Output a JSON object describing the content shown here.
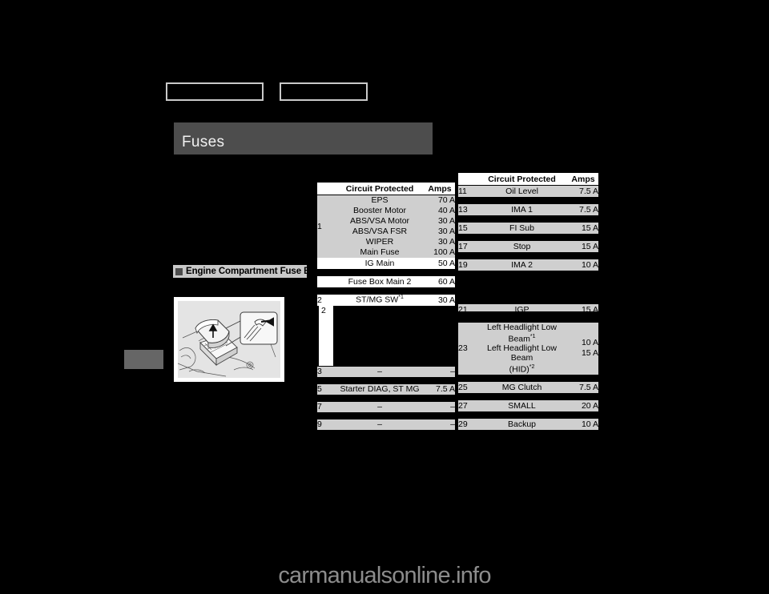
{
  "page": {
    "section_title": "Fuses",
    "subsection_title": "Engine Compartment Fuse Box",
    "watermark": "carmanualsonline.info",
    "colors": {
      "page_background": "#000000",
      "title_bar": "#4d4d4d",
      "subhead_bar": "#c9c9c9",
      "row_shade": "#cfcfcf",
      "row_plain": "#ffffff",
      "edge_tab": "#666666",
      "watermark_text": "#8c8c8c"
    },
    "top_boxes": [
      {
        "name": "redacted-box-left",
        "label": ""
      },
      {
        "name": "redacted-box-right",
        "label": ""
      }
    ],
    "illustration": {
      "name": "engine-compartment-fuse-box-illustration",
      "caption": ""
    }
  },
  "tables": {
    "left": {
      "headers": [
        "",
        "Circuit Protected",
        "Amps"
      ],
      "rows": [
        {
          "num": "1",
          "num_rowspan": 6,
          "desc": "EPS",
          "amps": "70 A",
          "style": "shade"
        },
        {
          "num": "",
          "desc": "Booster Motor",
          "amps": "40 A",
          "style": "shade"
        },
        {
          "num": "",
          "desc": "ABS/VSA Motor",
          "amps": "30 A",
          "style": "shade"
        },
        {
          "num": "",
          "desc": "ABS/VSA FSR",
          "amps": "30 A",
          "style": "shade"
        },
        {
          "num": "",
          "desc": "WIPER",
          "amps": "30 A",
          "style": "shade"
        },
        {
          "num": "",
          "desc": "Main Fuse",
          "amps": "100 A",
          "style": "shade"
        },
        {
          "num": "",
          "desc": "IG Main",
          "amps": "50 A",
          "style": "plain"
        },
        {
          "num": "",
          "desc": "Fuse Box Main 2",
          "amps": "60 A",
          "style": "plain"
        },
        {
          "num": "2",
          "desc": "ST/MG SW",
          "desc_sup": "*1",
          "amps": "30 A",
          "style": "plain"
        },
        {
          "num": "3",
          "desc": "–",
          "amps": "–",
          "style": "shade"
        },
        {
          "num": "5",
          "desc": "Starter DIAG, ST MG",
          "amps": "7.5 A",
          "style": "shade"
        },
        {
          "num": "7",
          "desc": "–",
          "amps": "–",
          "style": "shade"
        },
        {
          "num": "9",
          "desc": "–",
          "amps": "–",
          "style": "shade"
        }
      ]
    },
    "right": {
      "headers": [
        "",
        "Circuit Protected",
        "Amps"
      ],
      "rows": [
        {
          "num": "11",
          "desc": "Oil Level",
          "amps": "7.5 A",
          "style": "shade"
        },
        {
          "num": "13",
          "desc": "IMA 1",
          "amps": "7.5 A",
          "style": "shade"
        },
        {
          "num": "15",
          "desc": "FI Sub",
          "amps": "15 A",
          "style": "shade"
        },
        {
          "num": "17",
          "desc": "Stop",
          "amps": "15 A",
          "style": "shade"
        },
        {
          "num": "19",
          "desc": "IMA 2",
          "amps": "10 A",
          "style": "shade"
        },
        {
          "num": "21",
          "desc": "IGP",
          "amps": "15 A",
          "style": "shade"
        },
        {
          "num": "23",
          "desc_line1": "Left Headlight Low Beam",
          "desc_line1_sup": "*1",
          "desc_line2": "Left Headlight Low Beam",
          "desc_line3": "(HID)",
          "desc_line3_sup": "*2",
          "amps_line1": "10 A",
          "amps_line2": "15 A",
          "style": "shade"
        },
        {
          "num": "25",
          "desc": "MG Clutch",
          "amps": "7.5 A",
          "style": "shade"
        },
        {
          "num": "27",
          "desc": "SMALL",
          "amps": "20 A",
          "style": "shade"
        },
        {
          "num": "29",
          "desc": "Backup",
          "amps": "10 A",
          "style": "shade"
        }
      ]
    }
  }
}
